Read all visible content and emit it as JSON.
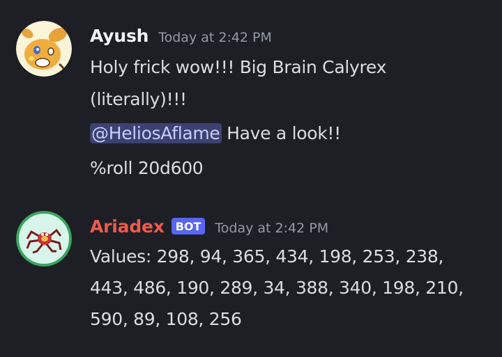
{
  "messages": [
    {
      "author": "Ayush",
      "timestamp": "Today at 2:42 PM",
      "lines": [
        "Holy frick wow!!! Big Brain Calyrex",
        "(literally)!!!"
      ],
      "mention": "@HeliosAflame",
      "mention_suffix": " Have a look!!",
      "command": "%roll 20d600",
      "avatar_icon": "raichu-avatar-icon"
    },
    {
      "author": "Ariadex",
      "bot_tag": "BOT",
      "timestamp": "Today at 2:42 PM",
      "lines": [
        "Values: 298, 94, 365, 434, 198, 253, 238,",
        "443, 486, 190, 289, 34, 388, 340, 198, 210,",
        "590, 89, 108, 256"
      ],
      "avatar_icon": "ariados-avatar-icon"
    }
  ],
  "colors": {
    "background": "#1e1f25",
    "bot_name": "#ef5b4b",
    "bot_tag": "#5865f2",
    "mention_bg": "#3c4270",
    "mention_text": "#c9cdfb",
    "avatar_ring": "#3ba55d"
  }
}
